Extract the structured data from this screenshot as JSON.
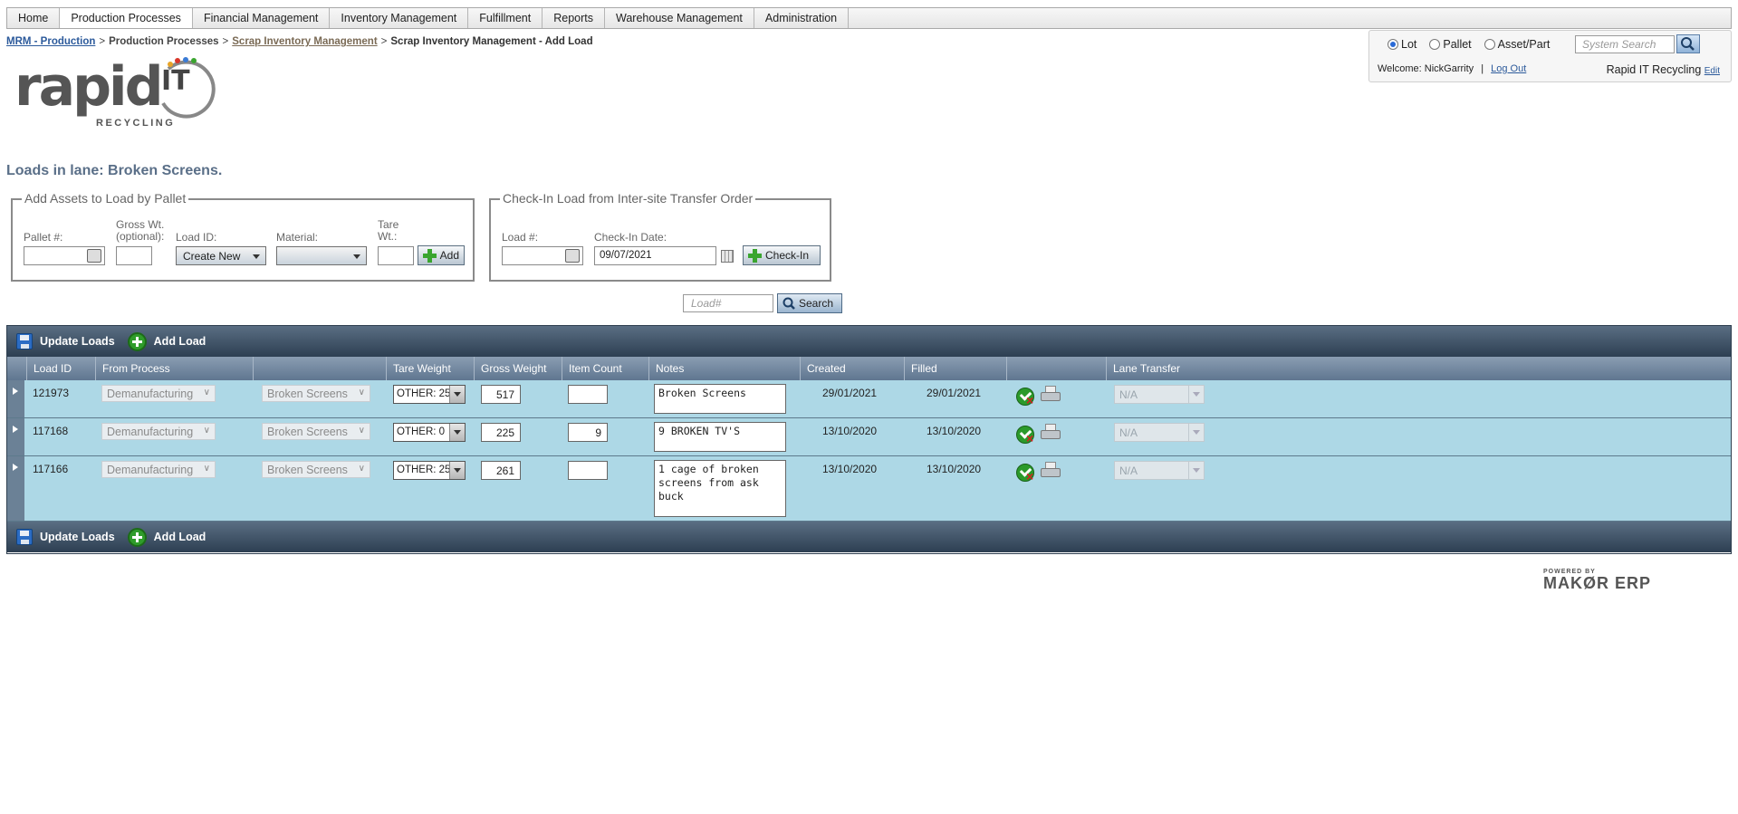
{
  "nav": {
    "items": [
      "Home",
      "Production Processes",
      "Financial Management",
      "Inventory Management",
      "Fulfillment",
      "Reports",
      "Warehouse Management",
      "Administration"
    ],
    "active_index": 1
  },
  "breadcrumb": {
    "crumb1": "MRM - Production",
    "crumb2": "Production Processes",
    "crumb3": "Scrap Inventory Management",
    "current": "Scrap Inventory Management - Add Load",
    "separator": ">"
  },
  "logo": {
    "word": "rapid",
    "it": "IT",
    "tagline": "RECYCLING"
  },
  "search_panel": {
    "radio_lot": "Lot",
    "radio_pallet": "Pallet",
    "radio_asset": "Asset/Part",
    "selected": "Lot",
    "placeholder": "System Search",
    "welcome": "Welcome: NickGarrity",
    "divider": "|",
    "logout": "Log Out",
    "company": "Rapid IT Recycling",
    "edit": "Edit"
  },
  "heading": "Loads in lane: Broken Screens.",
  "add_assets": {
    "legend": "Add Assets to Load by Pallet",
    "pallet_label": "Pallet #:",
    "gross_label_1": "Gross Wt.",
    "gross_label_2": "(optional):",
    "loadid_label": "Load ID:",
    "loadid_value": "Create New",
    "material_label": "Material:",
    "tare_label_1": "Tare",
    "tare_label_2": "Wt.:",
    "add_button": "Add"
  },
  "checkin": {
    "legend": "Check-In Load from Inter-site Transfer Order",
    "load_label": "Load #:",
    "date_label": "Check-In Date:",
    "date_value": "09/07/2021",
    "button": "Check-In"
  },
  "load_search": {
    "placeholder": "Load#",
    "button": "Search"
  },
  "grid": {
    "update_label": "Update Loads",
    "add_label": "Add Load",
    "columns": {
      "load_id": "Load ID",
      "from_process": "From Process",
      "tare_weight": "Tare Weight",
      "gross_weight": "Gross Weight",
      "item_count": "Item Count",
      "notes": "Notes",
      "created": "Created",
      "filled": "Filled",
      "lane_transfer": "Lane Transfer"
    },
    "rows": [
      {
        "load_id": "121973",
        "process": "Demanufacturing",
        "lane": "Broken Screens",
        "tare": "OTHER: 25",
        "gross": "517",
        "count": "",
        "notes": "Broken Screens",
        "created": "29/01/2021",
        "filled": "29/01/2021",
        "transfer": "N/A"
      },
      {
        "load_id": "117168",
        "process": "Demanufacturing",
        "lane": "Broken Screens",
        "tare": "OTHER: 0",
        "gross": "225",
        "count": "9",
        "notes": "9 BROKEN TV'S",
        "created": "13/10/2020",
        "filled": "13/10/2020",
        "transfer": "N/A"
      },
      {
        "load_id": "117166",
        "process": "Demanufacturing",
        "lane": "Broken Screens",
        "tare": "OTHER: 25",
        "gross": "261",
        "count": "",
        "notes": "1 cage of broken\nscreens from ask\nbuck",
        "created": "13/10/2020",
        "filled": "13/10/2020",
        "transfer": "N/A"
      }
    ]
  },
  "footer": {
    "powered_by": "POWERED BY",
    "brand": "MAKØR ERP"
  }
}
